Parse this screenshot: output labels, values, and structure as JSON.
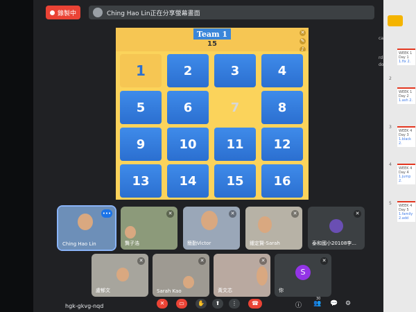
{
  "record_button": {
    "label": "錄製中"
  },
  "share_bar": {
    "text": "Ching Hao Lin正在分享螢幕畫面"
  },
  "board": {
    "team": "Team 1",
    "score": "15",
    "tiles": [
      {
        "label": "1",
        "state": "selected"
      },
      {
        "label": "2",
        "state": "normal"
      },
      {
        "label": "3",
        "state": "normal"
      },
      {
        "label": "4",
        "state": "normal"
      },
      {
        "label": "5",
        "state": "normal"
      },
      {
        "label": "6",
        "state": "normal"
      },
      {
        "label": "7",
        "state": "removed"
      },
      {
        "label": "8",
        "state": "normal"
      },
      {
        "label": "9",
        "state": "normal"
      },
      {
        "label": "10",
        "state": "normal"
      },
      {
        "label": "11",
        "state": "normal"
      },
      {
        "label": "12",
        "state": "normal"
      },
      {
        "label": "13",
        "state": "normal"
      },
      {
        "label": "14",
        "state": "normal"
      },
      {
        "label": "15",
        "state": "normal"
      },
      {
        "label": "16",
        "state": "normal"
      }
    ]
  },
  "participants": [
    {
      "name": "Ching Hao Lin"
    },
    {
      "name": "龔子浩"
    },
    {
      "name": "簡勤Victor"
    },
    {
      "name": "鍾定賢-Sarah"
    },
    {
      "name": "泰和國小20108李..."
    },
    {
      "name": "盧郁文"
    },
    {
      "name": "Sarah Kao"
    },
    {
      "name": "黃文芯"
    },
    {
      "name": "你",
      "avatar_letter": "S"
    }
  ],
  "meeting": {
    "code": "hgk-gkvg-nqd",
    "participant_count": "30"
  },
  "right_doc": {
    "weeks": [
      "WEEK 1",
      "WEEK 1",
      "WEEK 4",
      "WEEK 4",
      "WEEK 4"
    ],
    "days": [
      "Day 1",
      "Day 2",
      "Day 3",
      "Day 4",
      "Day 5"
    ],
    "links": [
      "1.fix 2.",
      "1.ash 2.",
      "1.black 2.",
      "1.jump 2.",
      "1.family 2.add"
    ],
    "page_numbers": [
      "2",
      "3",
      "4",
      "5"
    ]
  },
  "side_text": {
    "t1": "rd",
    "t2": "do",
    "t3": "ca"
  },
  "colors": {
    "accent": "#1a73e8",
    "record": "#ea4335",
    "tile_blue": "#2b6fd0",
    "board_yellow": "#f6c653"
  }
}
